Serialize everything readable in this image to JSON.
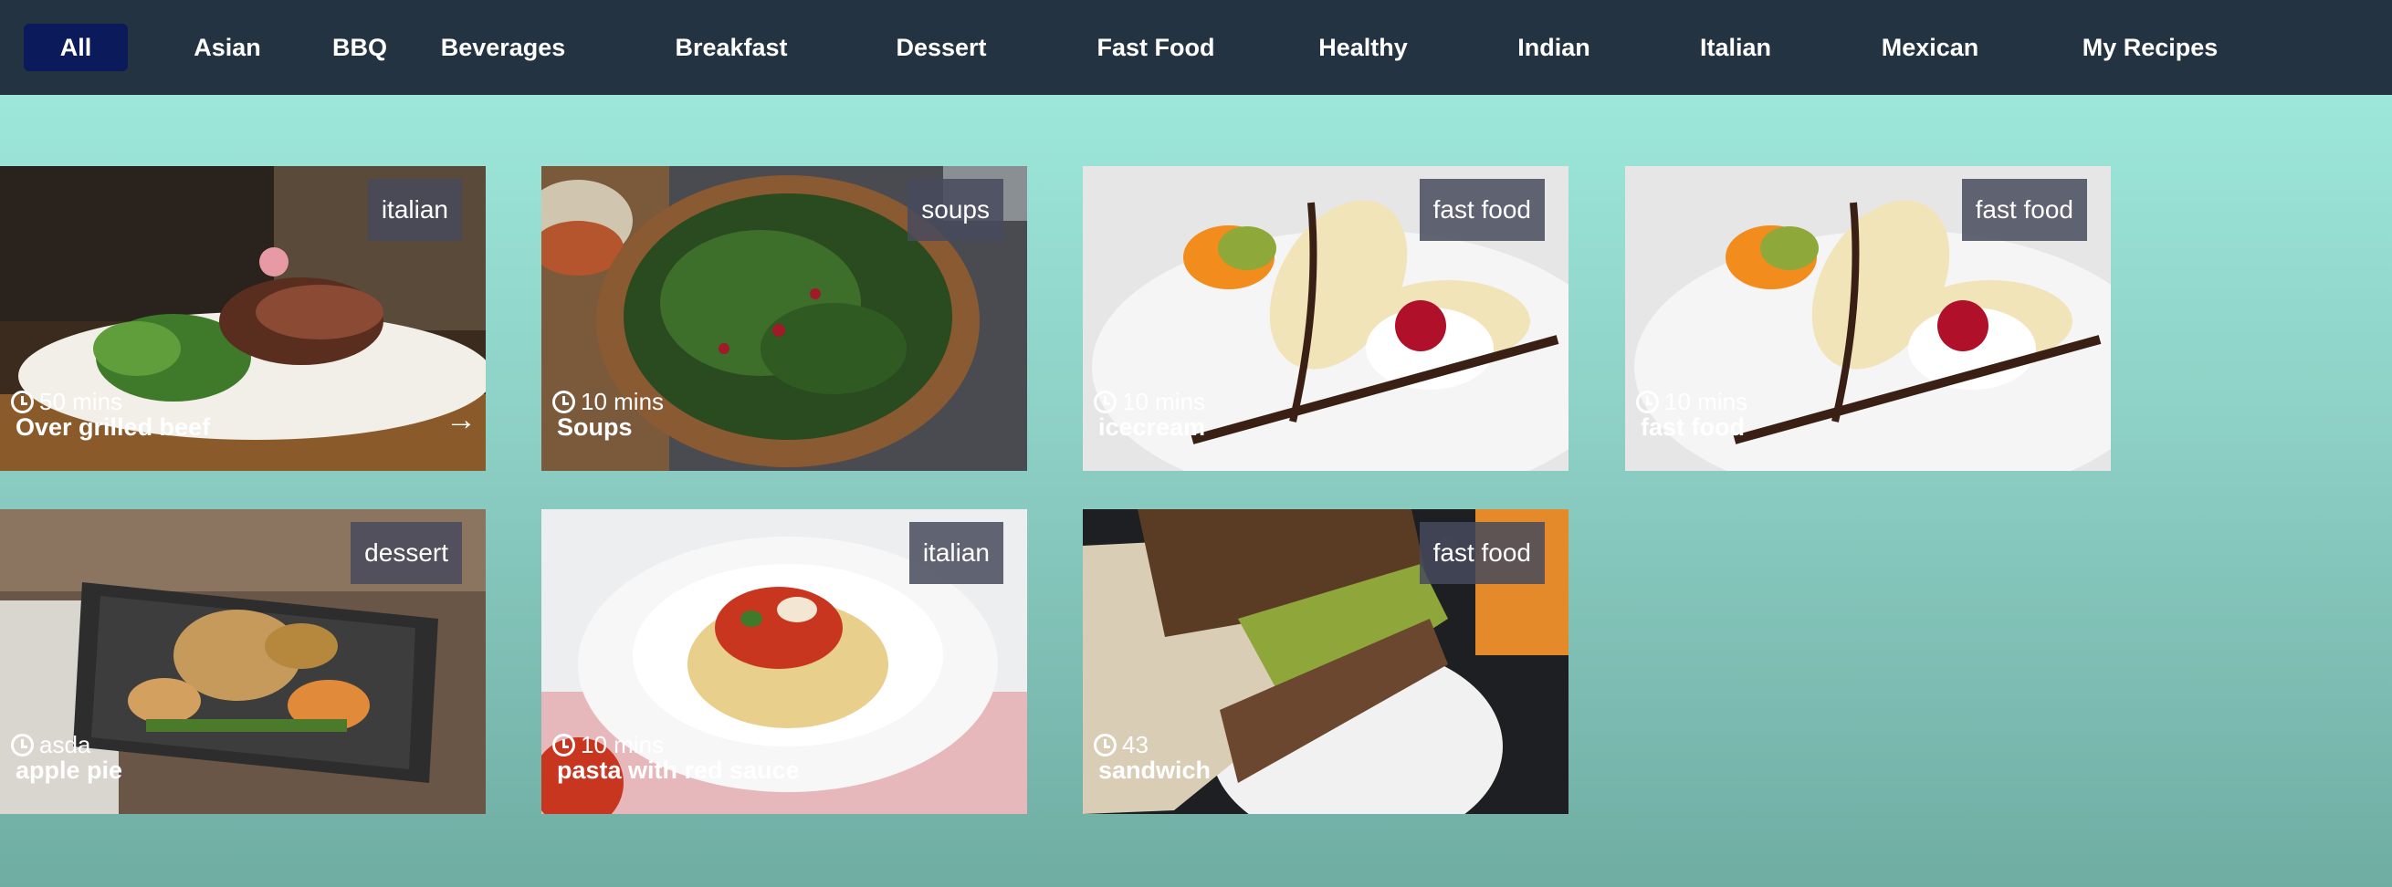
{
  "nav": {
    "items": [
      "All",
      "Asian",
      "BBQ",
      "Beverages",
      "Breakfast",
      "Dessert",
      "Fast Food",
      "Healthy",
      "Indian",
      "Italian",
      "Mexican",
      "My Recipes"
    ],
    "active": "All"
  },
  "recipes": [
    {
      "tag": "italian",
      "time": "50 mins",
      "name": "Over grilled beef",
      "arrow": "→"
    },
    {
      "tag": "soups",
      "time": "10 mins",
      "name": "Soups"
    },
    {
      "tag": "fast food",
      "time": "10 mins",
      "name": "icecream"
    },
    {
      "tag": "fast food",
      "time": "10 mins",
      "name": "fast food"
    },
    {
      "tag": "dessert",
      "time": "asda",
      "name": "apple pie"
    },
    {
      "tag": "italian",
      "time": "10 mins",
      "name": "pasta with red sauce"
    },
    {
      "tag": "fast food",
      "time": "43",
      "name": "sandwich"
    }
  ],
  "colors": {
    "nav_bg": "#233342",
    "nav_active": "#0a1a5a",
    "tag_bg": "#464a5c"
  }
}
